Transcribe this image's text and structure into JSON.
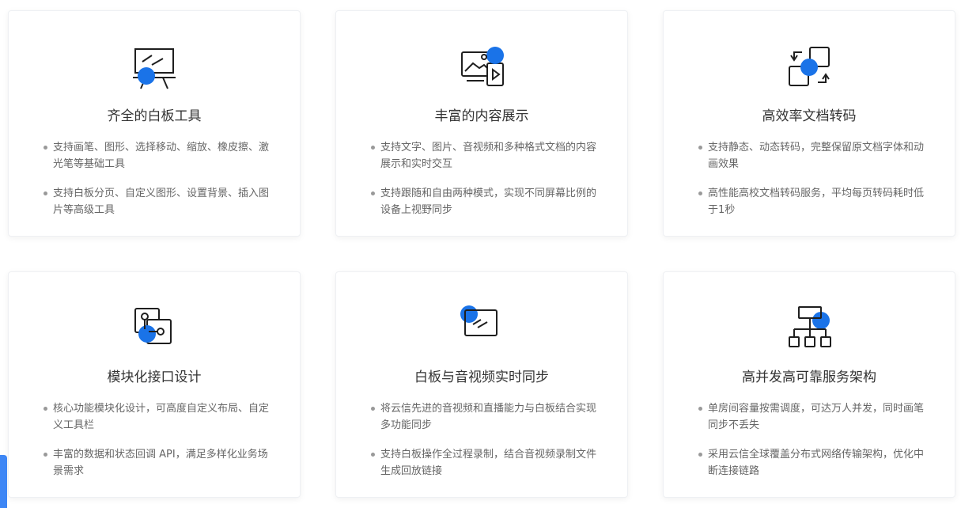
{
  "colors": {
    "accent": "#1a73e8",
    "stroke": "#1f1f1f",
    "title": "#333333",
    "body_text": "#666666",
    "bullet": "#999999",
    "side_tab": "#3d86f5"
  },
  "cards": [
    {
      "icon": "whiteboard-icon",
      "title": "齐全的白板工具",
      "features": [
        "支持画笔、图形、选择移动、缩放、橡皮擦、激光笔等基础工具",
        "支持白板分页、自定义图形、设置背景、插入图片等高级工具"
      ]
    },
    {
      "icon": "media-content-icon",
      "title": "丰富的内容展示",
      "features": [
        "支持文字、图片、音视频和多种格式文档的内容展示和实时交互",
        "支持跟随和自由两种模式，实现不同屏幕比例的设备上视野同步"
      ]
    },
    {
      "icon": "document-convert-icon",
      "title": "高效率文档转码",
      "features": [
        "支持静态、动态转码，完整保留原文档字体和动画效果",
        "高性能高校文档转码服务，平均每页转码耗时低于1秒"
      ]
    },
    {
      "icon": "modular-interface-icon",
      "title": "模块化接口设计",
      "features": [
        "核心功能模块化设计，可高度自定义布局、自定义工具栏",
        "丰富的数据和状态回调 API，满足多样化业务场景需求"
      ]
    },
    {
      "icon": "av-sync-icon",
      "title": "白板与音视频实时同步",
      "features": [
        "将云信先进的音视频和直播能力与白板结合实现多功能同步",
        "支持白板操作全过程录制，结合音视频录制文件生成回放链接"
      ]
    },
    {
      "icon": "architecture-icon",
      "title": "高并发高可靠服务架构",
      "features": [
        "单房间容量按需调度，可达万人并发，同时画笔同步不丢失",
        "采用云信全球覆盖分布式网络传输架构，优化中断连接链路"
      ]
    }
  ]
}
